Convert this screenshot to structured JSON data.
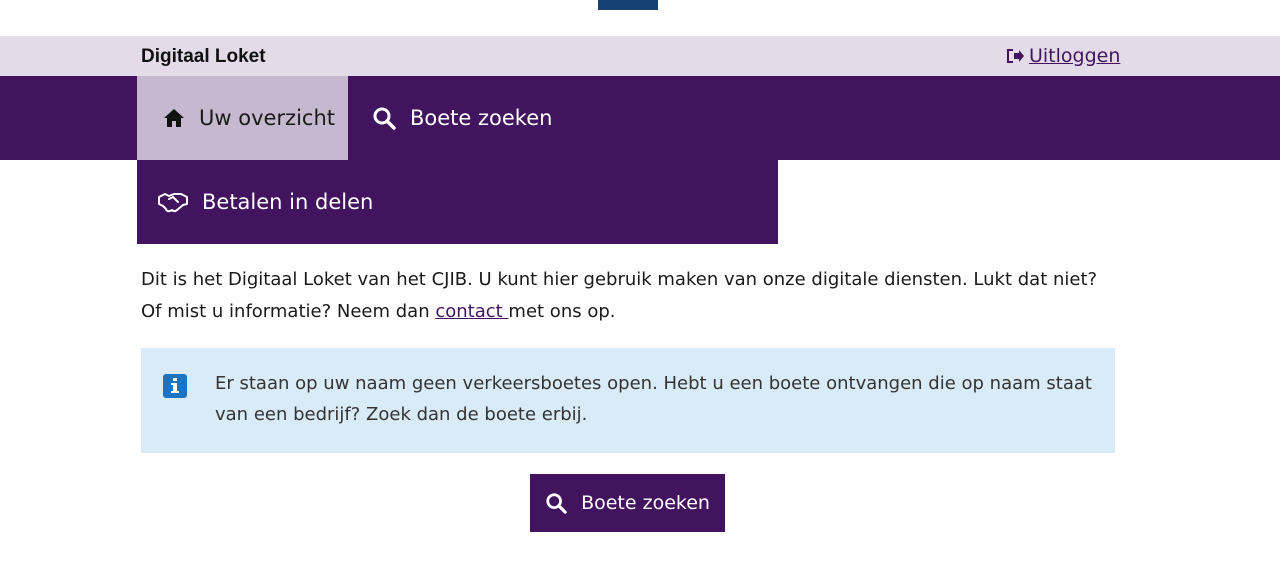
{
  "header": {
    "site_name": "Digitaal Loket",
    "logout_label": "Uitloggen"
  },
  "nav": {
    "items": [
      {
        "label": "Uw overzicht",
        "icon": "home-icon",
        "active": true
      },
      {
        "label": "Boete zoeken",
        "icon": "search-icon",
        "active": false
      },
      {
        "label": "Betalen in delen",
        "icon": "handshake-icon",
        "active": false
      }
    ]
  },
  "intro": {
    "text_before": "Dit is het Digitaal Loket van het CJIB. U kunt hier gebruik maken van onze digitale diensten. Lukt dat niet? Of mist u informatie? Neem dan ",
    "link_label": "contact ",
    "text_after": "met ons op."
  },
  "alert": {
    "icon": "info-icon",
    "message": "Er staan op uw naam geen verkeersboetes open. Hebt u een boete ontvangen die op naam staat van een bedrijf? Zoek dan de boete erbij."
  },
  "cta": {
    "label": "Boete zoeken",
    "icon": "search-icon"
  },
  "colors": {
    "brand_purple": "#42145f",
    "active_tab": "#c6b9cf",
    "topbar": "#e3dbe8",
    "alert_bg": "#d9ebf7",
    "info_blue": "#1a74c2"
  }
}
